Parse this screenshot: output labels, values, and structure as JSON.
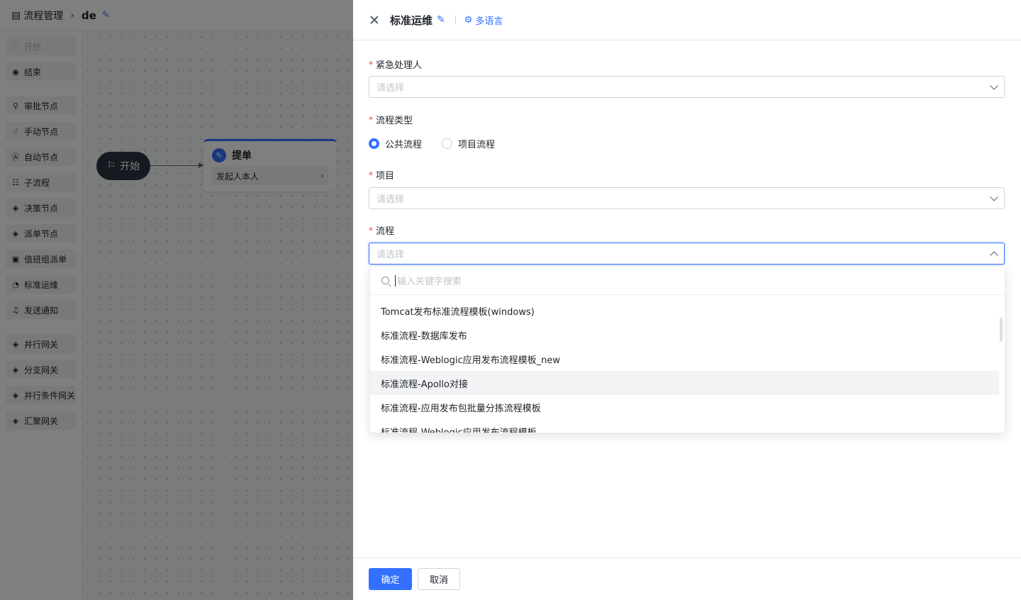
{
  "topbar": {
    "breadcrumb": "流程管理",
    "flow_name": "de"
  },
  "palette": {
    "groups": [
      [
        {
          "label": "开始",
          "icon": "flag-icon",
          "disabled": true
        },
        {
          "label": "结束",
          "icon": "stop-circle-icon"
        }
      ],
      [
        {
          "label": "审批节点",
          "icon": "stamp-icon"
        },
        {
          "label": "手动节点",
          "icon": "hand-icon"
        },
        {
          "label": "自动节点",
          "icon": "auto-icon"
        },
        {
          "label": "子流程",
          "icon": "subflow-icon"
        },
        {
          "label": "决策节点",
          "icon": "diamond-icon"
        },
        {
          "label": "派单节点",
          "icon": "diamond-icon"
        },
        {
          "label": "值班组派单",
          "icon": "calendar-icon"
        },
        {
          "label": "标准运维",
          "icon": "gauge-icon"
        },
        {
          "label": "发送通知",
          "icon": "bell-icon"
        }
      ],
      [
        {
          "label": "并行网关",
          "icon": "diamond-icon"
        },
        {
          "label": "分支网关",
          "icon": "diamond-icon"
        },
        {
          "label": "并行条件网关",
          "icon": "diamond-icon"
        },
        {
          "label": "汇聚网关",
          "icon": "diamond-icon"
        }
      ]
    ]
  },
  "canvas": {
    "start_node": "开始",
    "submit_node": {
      "title": "提单",
      "assignee": "发起人本人"
    }
  },
  "drawer": {
    "title": "标准运维",
    "i18n_label": "多语言",
    "fields": {
      "urgent_handler": {
        "label": "紧急处理人",
        "placeholder": "请选择"
      },
      "flow_type": {
        "label": "流程类型",
        "options": [
          "公共流程",
          "项目流程"
        ],
        "selected": "公共流程"
      },
      "project": {
        "label": "项目",
        "placeholder": "请选择"
      },
      "flow": {
        "label": "流程",
        "placeholder": "请选择"
      }
    },
    "dropdown": {
      "search_placeholder": "输入关键字搜索",
      "options": [
        "Tomcat发布标准流程模板(windows)",
        "标准流程-数据库发布",
        "标准流程-Weblogic应用发布流程模板_new",
        "标准流程-Apollo对接",
        "标准流程-应用发布包批量分拣流程模板",
        "标准流程-Weblogic应用发布流程模板"
      ],
      "hovered": "标准流程-Apollo对接"
    },
    "footer": {
      "confirm": "确定",
      "cancel": "取消"
    }
  },
  "colors": {
    "primary": "#3370ff",
    "required": "#f53f3f",
    "mask": "rgba(0,0,0,0.5)"
  }
}
